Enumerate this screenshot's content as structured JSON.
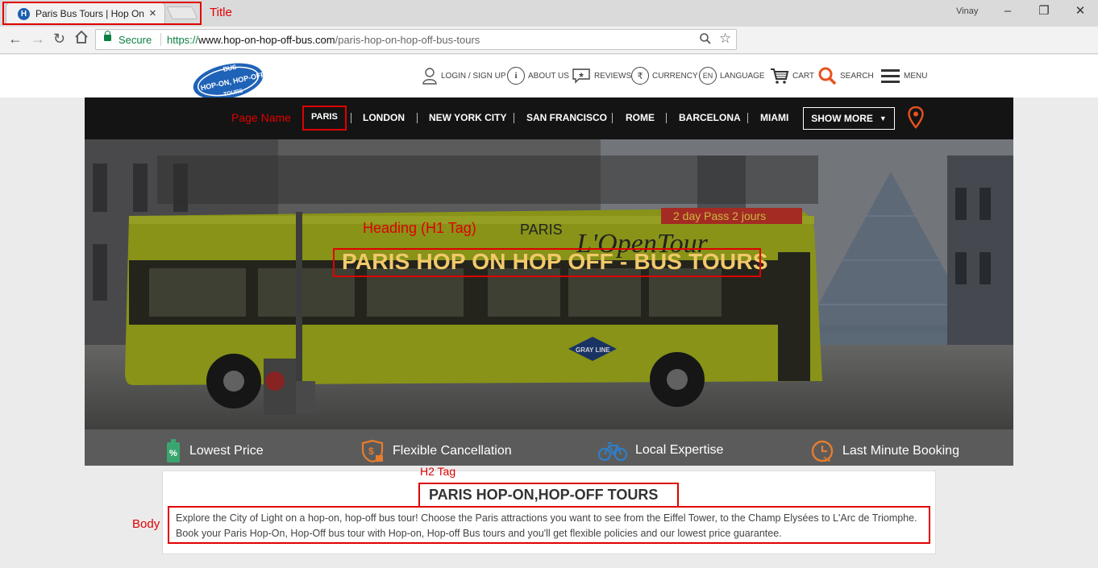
{
  "browser": {
    "tab_title": "Paris Bus Tours | Hop On",
    "tab_favicon_letter": "H",
    "tab_close": "×",
    "user": "Vinay",
    "window_controls": [
      "–",
      "❐",
      "✕"
    ],
    "security_label": "Secure",
    "url_scheme": "https://",
    "url_domain": "www.hop-on-hop-off-bus.com",
    "url_path": "/paris-hop-on-hop-off-bus-tours"
  },
  "annotations": {
    "title": "Title",
    "page_name": "Page Name",
    "h1_tag": "Heading (H1 Tag)",
    "h2_tag": "H2 Tag",
    "body": "Body",
    "color": "#e00000"
  },
  "header": {
    "logo_text_top": "BUS",
    "logo_text_mid": "HOP-ON, HOP-OFF",
    "logo_text_bottom": "TOURS",
    "items": [
      {
        "label": "LOGIN / SIGN UP",
        "icon": "user-icon"
      },
      {
        "label": "ABOUT US",
        "icon": "info-icon"
      },
      {
        "label": "REVIEWS",
        "icon": "reviews-icon"
      },
      {
        "label": "CURRENCY",
        "icon": "rupee-icon"
      },
      {
        "label": "LANGUAGE",
        "icon": "language-icon",
        "icon_text": "EN"
      },
      {
        "label": "CART",
        "icon": "cart-icon"
      },
      {
        "label": "SEARCH",
        "icon": "search-icon"
      },
      {
        "label": "MENU",
        "icon": "menu-icon"
      }
    ]
  },
  "city_nav": {
    "items": [
      "PARIS",
      "LONDON",
      "NEW YORK CITY",
      "SAN FRANCISCO",
      "ROME",
      "BARCELONA",
      "MIAMI"
    ],
    "active": "PARIS",
    "show_more": "SHOW MORE"
  },
  "hero": {
    "h1": "PARIS HOP ON HOP OFF - BUS TOURS",
    "h1_color": "#f2c96b",
    "bus_sign_paris": "PARIS",
    "bus_sign_brand": "L'OpenTour",
    "bus_pass": "2 day Pass 2 jours",
    "bus_badge": "GRAY LINE"
  },
  "features": [
    {
      "label": "Lowest Price",
      "icon": "price-tag-icon",
      "color": "#3aa66f"
    },
    {
      "label": "Flexible Cancellation",
      "icon": "cancellation-icon",
      "color": "#e87c2d"
    },
    {
      "label": "Local Expertise",
      "icon": "bicycle-icon",
      "color": "#2f7fc8"
    },
    {
      "label": "Last Minute Booking",
      "icon": "clock-24-icon",
      "color": "#e87c2d"
    }
  ],
  "content": {
    "h2": "PARIS HOP-ON,HOP-OFF TOURS",
    "body": "Explore the City of Light on a hop-on, hop-off bus tour! Choose the Paris attractions you want to see from the Eiffel Tower, to the Champ Elysées to L'Arc de Triomphe. Book your Paris Hop-On, Hop-Off bus tour with Hop-on, Hop-off Bus tours and you'll get flexible policies and our lowest price guarantee."
  }
}
